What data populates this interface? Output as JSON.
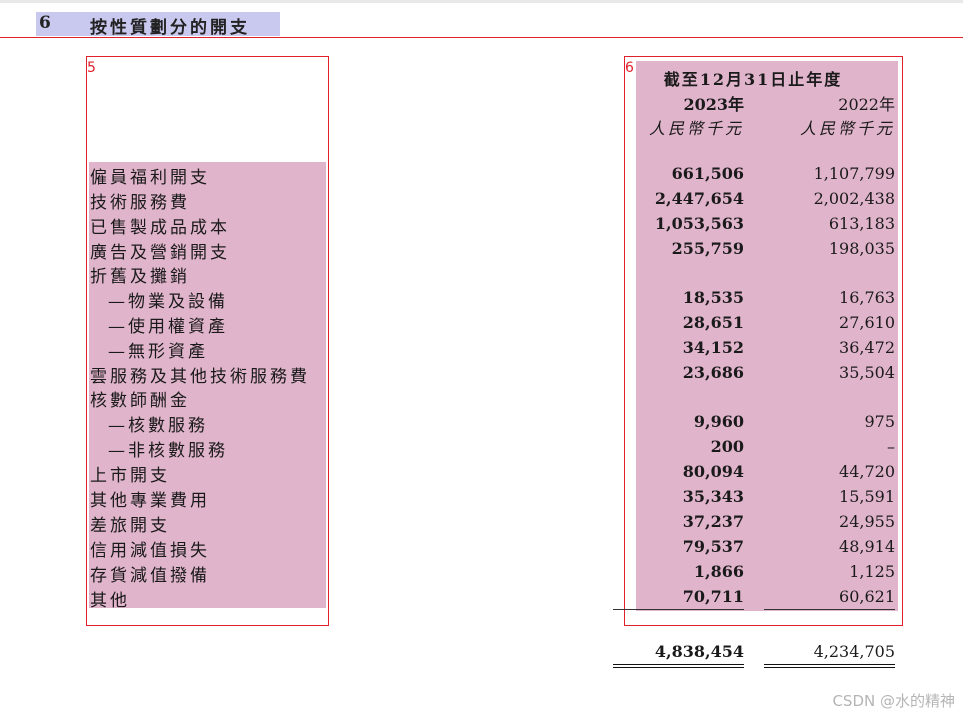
{
  "section": {
    "number": "6",
    "title": "按性質劃分的開支"
  },
  "annotations": {
    "left_box_label": "5",
    "right_box_label": "6"
  },
  "header": {
    "period": "截至12月31日止年度",
    "year_current": "2023年",
    "year_prior": "2022年",
    "unit_current": "人民幣千元",
    "unit_prior": "人民幣千元"
  },
  "rows": [
    {
      "label": "僱員福利開支",
      "y2023": "661,506",
      "y2022": "1,107,799"
    },
    {
      "label": "技術服務費",
      "y2023": "2,447,654",
      "y2022": "2,002,438"
    },
    {
      "label": "已售製成品成本",
      "y2023": "1,053,563",
      "y2022": "613,183"
    },
    {
      "label": "廣告及營銷開支",
      "y2023": "255,759",
      "y2022": "198,035"
    },
    {
      "label": "折舊及攤銷",
      "y2023": "",
      "y2022": ""
    },
    {
      "label": "—物業及設備",
      "y2023": "18,535",
      "y2022": "16,763"
    },
    {
      "label": "—使用權資產",
      "y2023": "28,651",
      "y2022": "27,610"
    },
    {
      "label": "—無形資產",
      "y2023": "34,152",
      "y2022": "36,472"
    },
    {
      "label": "雲服務及其他技術服務費",
      "y2023": "23,686",
      "y2022": "35,504"
    },
    {
      "label": "核數師酬金",
      "y2023": "",
      "y2022": ""
    },
    {
      "label": "—核數服務",
      "y2023": "9,960",
      "y2022": "975"
    },
    {
      "label": "—非核數服務",
      "y2023": "200",
      "y2022": "–"
    },
    {
      "label": "上市開支",
      "y2023": "80,094",
      "y2022": "44,720"
    },
    {
      "label": "其他專業費用",
      "y2023": "35,343",
      "y2022": "15,591"
    },
    {
      "label": "差旅開支",
      "y2023": "37,237",
      "y2022": "24,955"
    },
    {
      "label": "信用減值損失",
      "y2023": "79,537",
      "y2022": "48,914"
    },
    {
      "label": "存貨減值撥備",
      "y2023": "1,866",
      "y2022": "1,125"
    },
    {
      "label": "其他",
      "y2023": "70,711",
      "y2022": "60,621"
    }
  ],
  "total": {
    "y2023": "4,838,454",
    "y2022": "4,234,705"
  },
  "watermark": "CSDN @水的精神"
}
